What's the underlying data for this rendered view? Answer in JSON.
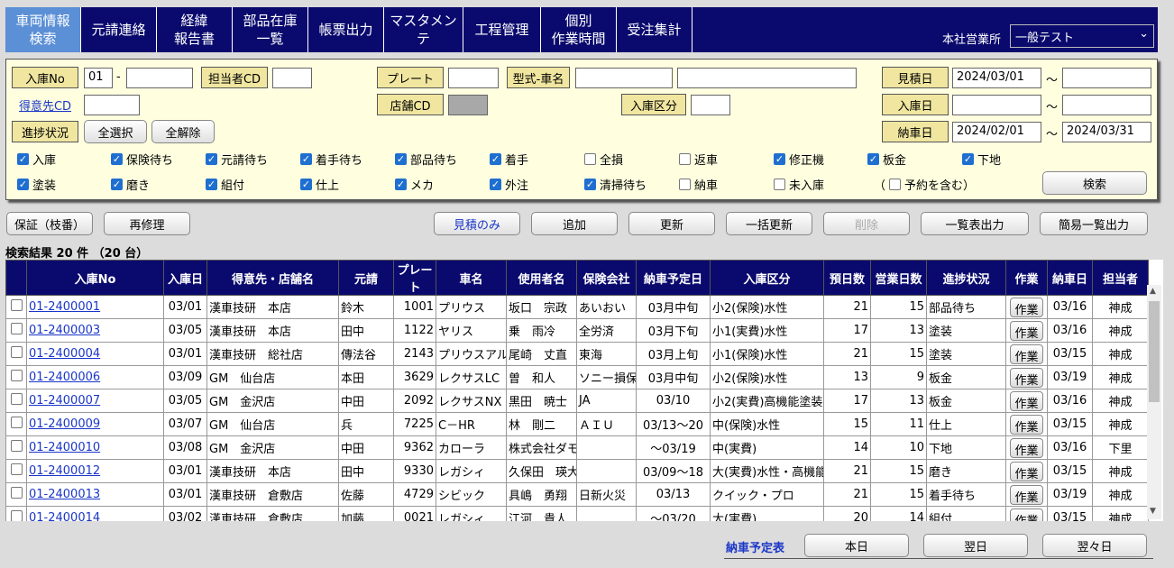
{
  "nav": {
    "items": [
      "車両情報\n検索",
      "元請連絡",
      "経緯\n報告書",
      "部品在庫\n一覧",
      "帳票出力",
      "マスタメンテ",
      "工程管理",
      "個別\n作業時間",
      "受注集計"
    ],
    "office_label": "本社営業所",
    "office_value": "一般テスト"
  },
  "search": {
    "nyuko_no_label": "入庫No",
    "nyuko_no_prefix": "01",
    "dash": "-",
    "tanto_label": "担当者CD",
    "plate_label": "プレート",
    "katashiki_label": "型式-車名",
    "mitsumori_label": "見積日",
    "mitsumori_from": "2024/03/01",
    "tilde": "～",
    "tokuisaki_label": "得意先CD",
    "tenpo_label": "店舗CD",
    "nyuko_kubun_label": "入庫区分",
    "nyuko_date_label": "入庫日",
    "shinchoku_label": "進捗状況",
    "select_all": "全選択",
    "deselect_all": "全解除",
    "nosha_label": "納車日",
    "nosha_from": "2024/02/01",
    "nosha_to": "2024/03/31",
    "yoyaku_open": "（",
    "yoyaku_label": "予約を含む）",
    "search_button": "検索",
    "checks_row1": [
      {
        "label": "入庫",
        "checked": true
      },
      {
        "label": "保険待ち",
        "checked": true
      },
      {
        "label": "元請待ち",
        "checked": true
      },
      {
        "label": "着手待ち",
        "checked": true
      },
      {
        "label": "部品待ち",
        "checked": true
      },
      {
        "label": "着手",
        "checked": true
      },
      {
        "label": "全損",
        "checked": false
      },
      {
        "label": "返車",
        "checked": false
      },
      {
        "label": "修正機",
        "checked": true
      },
      {
        "label": "板金",
        "checked": true
      },
      {
        "label": "下地",
        "checked": true
      }
    ],
    "checks_row2": [
      {
        "label": "塗装",
        "checked": true
      },
      {
        "label": "磨き",
        "checked": true
      },
      {
        "label": "組付",
        "checked": true
      },
      {
        "label": "仕上",
        "checked": true
      },
      {
        "label": "メカ",
        "checked": true
      },
      {
        "label": "外注",
        "checked": true
      },
      {
        "label": "清掃待ち",
        "checked": true
      },
      {
        "label": "納車",
        "checked": false
      },
      {
        "label": "未入庫",
        "checked": false
      }
    ]
  },
  "actions": {
    "hosho": "保証（枝番）",
    "saishuri": "再修理",
    "mitsumori_only": "見積のみ",
    "add": "追加",
    "update": "更新",
    "bulk_update": "一括更新",
    "delete": "削除",
    "list_output": "一覧表出力",
    "simple_list_output": "簡易一覧出力"
  },
  "results": {
    "summary": "検索結果 20 件 （20 台）",
    "columns": [
      "",
      "入庫No",
      "入庫日",
      "得意先・店舗名",
      "元請",
      "プレート",
      "車名",
      "使用者名",
      "保険会社",
      "納車予定日",
      "入庫区分",
      "預日数",
      "営業日数",
      "進捗状況",
      "作業",
      "納車日",
      "担当者"
    ],
    "work_label": "作業",
    "rows": [
      [
        "01-2400001",
        "03/01",
        "漢車技研　本店",
        "鈴木",
        "1001",
        "プリウス",
        "坂口　宗政",
        "あいおい",
        "03月中旬",
        "小2(保険)水性",
        "21",
        "15",
        "部品待ち",
        "03/16",
        "神成"
      ],
      [
        "01-2400003",
        "03/05",
        "漢車技研　本店",
        "田中",
        "1122",
        "ヤリス",
        "乗　雨冷",
        "全労済",
        "03月下旬",
        "小1(実費)水性",
        "17",
        "13",
        "塗装",
        "03/16",
        "神成"
      ],
      [
        "01-2400004",
        "03/01",
        "漢車技研　総社店",
        "傳法谷",
        "2143",
        "プリウスアルファ",
        "尾崎　丈直",
        "東海",
        "03月上旬",
        "小1(保険)水性",
        "21",
        "15",
        "塗装",
        "03/15",
        "神成"
      ],
      [
        "01-2400006",
        "03/09",
        "GM　仙台店",
        "本田",
        "3629",
        "レクサスLC",
        "曽　和人",
        "ソニー損保",
        "03月中旬",
        "小2(保険)水性",
        "13",
        "9",
        "板金",
        "03/19",
        "神成"
      ],
      [
        "01-2400007",
        "03/05",
        "GM　金沢店",
        "中田",
        "2092",
        "レクサスNX",
        "黒田　暁士",
        "JA",
        "03/10",
        "小2(実費)高機能塗装",
        "17",
        "13",
        "板金",
        "03/16",
        "神成"
      ],
      [
        "01-2400009",
        "03/07",
        "GM　仙台店",
        "兵",
        "7225",
        "C－HR",
        "林　剛二",
        "ＡＩＵ",
        "03/13～20",
        "中(保険)水性",
        "15",
        "11",
        "仕上",
        "03/15",
        "神成"
      ],
      [
        "01-2400010",
        "03/08",
        "GM　金沢店",
        "中田",
        "9362",
        "カローラ",
        "株式会社ダモ",
        "",
        "～03/19",
        "中(実費)",
        "14",
        "10",
        "下地",
        "03/16",
        "下里"
      ],
      [
        "01-2400012",
        "03/01",
        "漢車技研　本店",
        "田中",
        "9330",
        "レガシィ",
        "久保田　瑛大",
        "",
        "03/09～18",
        "大(実費)水性・高機能",
        "21",
        "15",
        "磨き",
        "03/15",
        "神成"
      ],
      [
        "01-2400013",
        "03/01",
        "漢車技研　倉敷店",
        "佐藤",
        "4729",
        "シビック",
        "具嶋　勇翔",
        "日新火災",
        "03/13",
        "クイック・プロ",
        "21",
        "15",
        "着手待ち",
        "03/19",
        "神成"
      ],
      [
        "01-2400014",
        "03/02",
        "漢車技研　倉敷店",
        "加藤",
        "0021",
        "レガシィ",
        "江河　貴人",
        "",
        "～03/20",
        "大(実費)",
        "20",
        "14",
        "組付",
        "03/15",
        "神成"
      ]
    ]
  },
  "schedule": {
    "label": "納車予定表",
    "today": "本日",
    "tomorrow": "翌日",
    "day_after": "翌々日"
  }
}
